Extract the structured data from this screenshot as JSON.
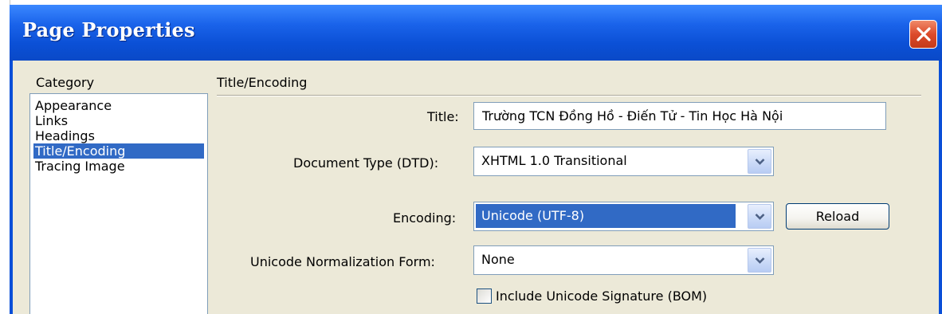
{
  "window": {
    "title": "Page Properties"
  },
  "category": {
    "label": "Category",
    "items": [
      {
        "label": "Appearance",
        "selected": false
      },
      {
        "label": "Links",
        "selected": false
      },
      {
        "label": "Headings",
        "selected": false
      },
      {
        "label": "Title/Encoding",
        "selected": true
      },
      {
        "label": "Tracing Image",
        "selected": false
      }
    ]
  },
  "section": {
    "title": "Title/Encoding"
  },
  "form": {
    "title_label": "Title:",
    "title_value": "Trường TCN Đồng Hồ - Điến Tử - Tin Học Hà Nội",
    "doctype_label": "Document Type (DTD):",
    "doctype_value": "XHTML 1.0 Transitional",
    "encoding_label": "Encoding:",
    "encoding_value": "Unicode (UTF-8)",
    "reload_label": "Reload",
    "normalization_label": "Unicode Normalization Form:",
    "normalization_value": "None",
    "bom_label": "Include Unicode Signature (BOM)",
    "bom_checked": false
  },
  "colors": {
    "titlebar": "#0a4fd8",
    "dialog_bg": "#ece9d8",
    "selection": "#316ac5",
    "close_button": "#dc4a2a"
  },
  "icons": {
    "close": "close-icon",
    "dropdown": "chevron-down-icon"
  }
}
